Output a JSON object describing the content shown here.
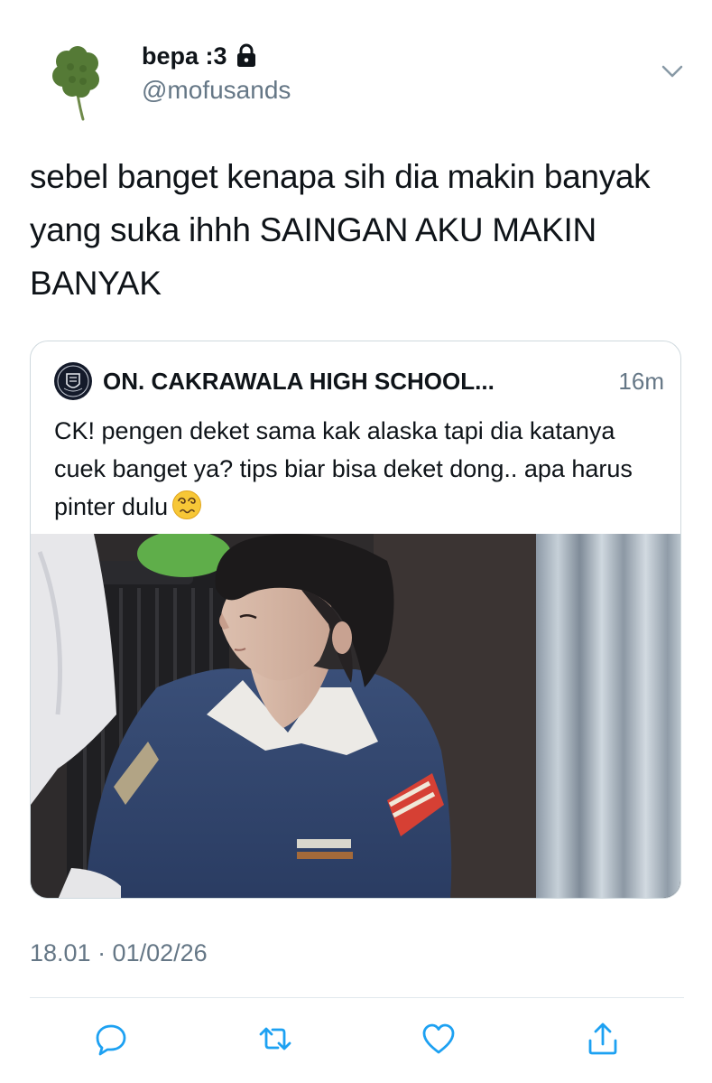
{
  "tweet": {
    "author": {
      "display_name": "bepa :3",
      "handle": "@mofusands",
      "avatar_icon": "four-leaf-clover-icon",
      "protected_icon": "lock-icon"
    },
    "text": "sebel banget kenapa sih dia makin banyak yang suka ihhh SAINGAN AKU MAKIN BANYAK",
    "more_menu_icon": "chevron-down-icon",
    "timestamp": "18.01 · 01/02/26"
  },
  "quoted_tweet": {
    "author_name": "ON. CAKRAWALA HIGH SCHOOL...",
    "time": "16m",
    "text": "CK! pengen deket sama kak alaska tapi dia katanya cuek banget ya? tips biar bisa deket dong.. apa harus pinter dulu",
    "emoji_icon": "dizzy-face-emoji-icon",
    "avatar_icon": "school-crest-icon"
  },
  "actions": [
    {
      "icon": "reply-icon"
    },
    {
      "icon": "retweet-icon"
    },
    {
      "icon": "like-icon"
    },
    {
      "icon": "share-icon"
    }
  ],
  "colors": {
    "text_primary": "#0f1419",
    "text_secondary": "#657786",
    "border": "#cfd9de",
    "action_icon": "#1da1f2"
  }
}
